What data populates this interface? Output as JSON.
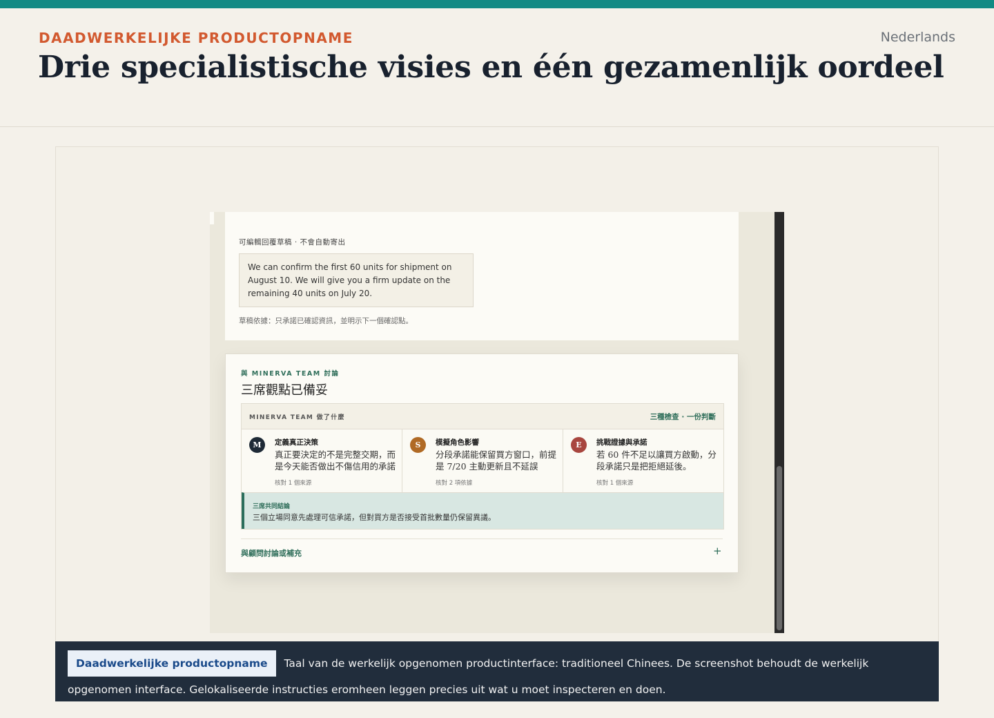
{
  "page": {
    "eyebrow": "DAADWERKELIJKE PRODUCTOPNAME",
    "title": "Drie specialistische visies en één gezamenlijk oordeel",
    "language": "Nederlands",
    "accent_color": "#128a84",
    "eyebrow_color": "#d2592f"
  },
  "screenshot": {
    "draft": {
      "label": "可編輯回覆草稿 · 不會自動寄出",
      "text": "We can confirm the first 60 units for shipment on August 10. We will give you a firm update on the remaining 40 units on July 20.",
      "basis": "草稿依據：只承諾已確認資訊，並明示下一個確認點。"
    },
    "panel": {
      "label": "與 MINERVA TEAM 討論",
      "title": "三席觀點已備妥",
      "team_heading": "MINERVA TEAM 做了什麼",
      "team_summary": "三種檢查 · 一份判斷",
      "roles": [
        {
          "initial": "M",
          "title": "定義真正決策",
          "text": "真正要決定的不是完整交期，而是今天能否做出不傷信用的承諾",
          "source": "核對 1 個來源",
          "color": "#1e2a36"
        },
        {
          "initial": "S",
          "title": "模擬角色影響",
          "text": "分段承諾能保留買方窗口，前提是 7/20 主動更新且不延誤",
          "source": "核對 2 項依據",
          "color": "#b06a25"
        },
        {
          "initial": "E",
          "title": "挑戰證據與承諾",
          "text": "若 60 件不足以讓買方啟動，分段承諾只是把拒絕延後。",
          "source": "核對 1 個來源",
          "color": "#a8463f"
        }
      ],
      "verdict_label": "三席共同結論",
      "verdict_text": "三個立場同意先處理可信承諾，但對買方是否接受首批數量仍保留異議。",
      "advisor_label": "與顧問討論或補充",
      "advisor_icon": "plus-icon"
    }
  },
  "caption": {
    "badge": "Daadwerkelijke productopname",
    "text": "Taal van de werkelijk opgenomen productinterface: traditioneel Chinees. De screenshot behoudt de werkelijk opgenomen interface. Gelokaliseerde instructies eromheen leggen precies uit wat u moet inspecteren en doen."
  }
}
